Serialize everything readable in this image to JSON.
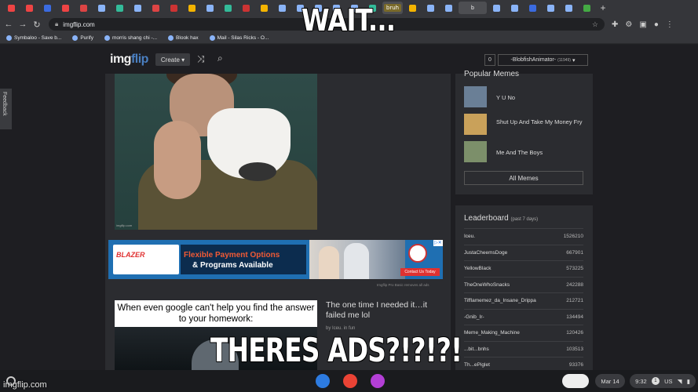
{
  "captions": {
    "top": "WAIT...",
    "bottom": "THERES ADS?!?!?!"
  },
  "browser": {
    "tabs": [
      {
        "color": "#e44"
      },
      {
        "color": "#e44"
      },
      {
        "color": "#3b6be0"
      },
      {
        "color": "#e44"
      },
      {
        "color": "#d44"
      },
      {
        "color": "#8ab4f8"
      },
      {
        "color": "#3b9"
      },
      {
        "color": "#8ab4f8"
      },
      {
        "color": "#d44"
      },
      {
        "color": "#c33"
      },
      {
        "color": "#f4b400"
      },
      {
        "color": "#8ab4f8"
      },
      {
        "color": "#3b9"
      },
      {
        "color": "#c33"
      },
      {
        "color": "#f4b400"
      },
      {
        "color": "#8ab4f8"
      },
      {
        "color": "#8ab4f8"
      },
      {
        "color": "#8ab4f8"
      },
      {
        "color": "#8ab4f8"
      },
      {
        "color": "#8ab4f8"
      },
      {
        "color": "#3b9"
      },
      {
        "color": "#f4b400"
      },
      {
        "color": "#8ab4f8"
      },
      {
        "color": "#8ab4f8"
      }
    ],
    "tab_bruh_label": "bruh",
    "active_tab": "b",
    "extra_tabs": [
      {
        "color": "#8ab4f8"
      },
      {
        "color": "#8ab4f8"
      },
      {
        "color": "#3b6be0"
      },
      {
        "color": "#8ab4f8"
      },
      {
        "color": "#8ab4f8"
      },
      {
        "color": "#4a4"
      }
    ],
    "url": "imgflip.com",
    "bookmarks": [
      {
        "label": "Symbaloo - Save b..."
      },
      {
        "label": "Purify"
      },
      {
        "label": "morris shang chi -..."
      },
      {
        "label": "Blook hax"
      },
      {
        "label": "Mail - Silas Ricks - O..."
      }
    ]
  },
  "header": {
    "logo_a": "img",
    "logo_b": "flip",
    "create_label": "Create ▾",
    "notif_count": "0",
    "username": "-BlobfishAnimator-",
    "user_points": "(11949)"
  },
  "feedback_label": "Feedback",
  "meme1": {
    "watermark": "imgflip.com"
  },
  "ad": {
    "brand": "BLAZER",
    "line1": "Flexible Payment Options",
    "line2": "& Programs Available",
    "cta": "Contact Us Today",
    "note": "Imgflip Pro Basic removes all ads"
  },
  "post2": {
    "caption": "When even google can't help you find the answer to your homework:",
    "title": "The one time I needed it…it failed me lol",
    "meta": "by Iceu. in fun"
  },
  "sidebar": {
    "popular_title": "Popular Memes",
    "popular": [
      {
        "label": "Y U No",
        "color": "#6a7f96"
      },
      {
        "label": "Shut Up And Take My Money Fry",
        "color": "#c9a15a"
      },
      {
        "label": "Me And The Boys",
        "color": "#7c8f6a"
      }
    ],
    "all_memes": "All Memes",
    "leaderboard_title": "Leaderboard",
    "leaderboard_period": "(past 7 days)",
    "leaderboard": [
      {
        "name": "Iceu.",
        "score": "1526210"
      },
      {
        "name": "JustaCheemsDoge",
        "score": "667901"
      },
      {
        "name": "YellowBlack",
        "score": "573225"
      },
      {
        "name": "TheOneWhoSnacks",
        "score": "242288"
      },
      {
        "name": "Tifflamemez_da_Insane_Drippa",
        "score": "212721"
      },
      {
        "name": "-Gnib_Ir-",
        "score": "134494"
      },
      {
        "name": "Meme_Making_Machine",
        "score": "120426"
      },
      {
        "name": "...bit...bnhs",
        "score": "103513"
      },
      {
        "name": "Th...ePiglet",
        "score": "93376"
      }
    ]
  },
  "shelf": {
    "apps": [
      {
        "color": "#2d7be0"
      },
      {
        "color": "#ea4335"
      },
      {
        "color": "#b33fd6"
      }
    ],
    "date": "Mar 14",
    "time": "9:32",
    "badge": "1",
    "locale": "US"
  },
  "watermark": "imgflip.com"
}
